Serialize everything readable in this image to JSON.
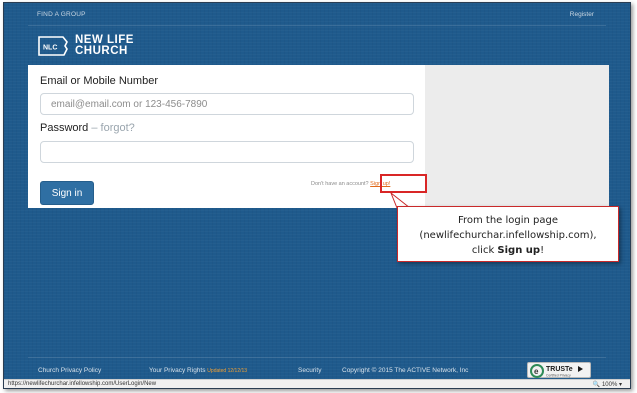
{
  "topnav": {
    "find_group": "FIND A GROUP",
    "register": "Register"
  },
  "logo": {
    "badge_text": "NLC",
    "line1": "NEW LIFE",
    "line2": "CHURCH"
  },
  "login": {
    "email_label": "Email or Mobile Number",
    "email_placeholder": "email@email.com or 123-456-7890",
    "password_label": "Password",
    "forgot_text": "– forgot?",
    "password_value": "",
    "signin_label": "Sign in",
    "no_account_text": "Don't have an account?",
    "signup_text": "Sign up!"
  },
  "callout": {
    "line1": "From the login page",
    "line2": "(newlifechurchar.infellowship.com),",
    "line3_prefix": "click ",
    "line3_bold": "Sign up",
    "line3_suffix": "!"
  },
  "footer": {
    "privacy_policy": "Church Privacy Policy",
    "privacy_rights": "Your Privacy Rights",
    "updated": "Updated 12/12/13",
    "security": "Security",
    "copyright": "Copyright © 2015 The ACTIVE Network, Inc",
    "truste_label": "TRUSTe",
    "truste_sub": "Certified Privacy"
  },
  "statusbar": {
    "url": "https://newlifechurchar.infellowship.com/UserLogin/New",
    "zoom": "100%"
  },
  "colors": {
    "background_blue": "#1f5a8c",
    "button_blue": "#2f6fa3",
    "signup_orange": "#e06a1b",
    "highlight_red": "#d92626"
  }
}
